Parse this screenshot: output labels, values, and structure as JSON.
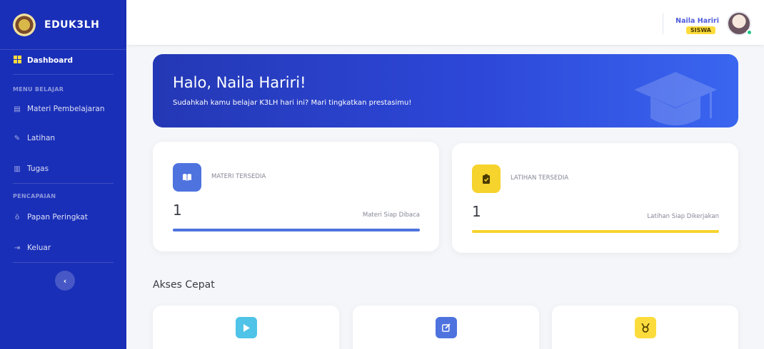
{
  "brand": {
    "name": "EDUK3LH"
  },
  "sidebar": {
    "dashboard": "Dashboard",
    "heading_belajar": "MENU BELAJAR",
    "materi": "Materi Pembelajaran",
    "latihan": "Latihan",
    "tugas": "Tugas",
    "heading_pencapaian": "PENCAPAIAN",
    "peringkat": "Papan Peringkat",
    "keluar": "Keluar"
  },
  "user": {
    "name": "Naila Hariri",
    "role": "SISWA"
  },
  "hero": {
    "title": "Halo, Naila Hariri!",
    "subtitle": "Sudahkah kamu belajar K3LH hari ini? Mari tingkatkan prestasimu!"
  },
  "stats": [
    {
      "label": "MATERI TERSEDIA",
      "value": "1",
      "note": "Materi Siap Dibaca",
      "color": "#4e73df",
      "progress": 1.0
    },
    {
      "label": "LATIHAN TERSEDIA",
      "value": "1",
      "note": "Latihan Siap Dikerjakan",
      "color": "#f6d32d",
      "progress": 1.0
    }
  ],
  "quick_access": {
    "title": "Akses Cepat",
    "items": [
      {
        "icon": "play-icon",
        "color": "#4fc3e8"
      },
      {
        "icon": "edit-icon",
        "color": "#4e73df"
      },
      {
        "icon": "medal-icon",
        "color": "#fcdc3c"
      }
    ]
  }
}
